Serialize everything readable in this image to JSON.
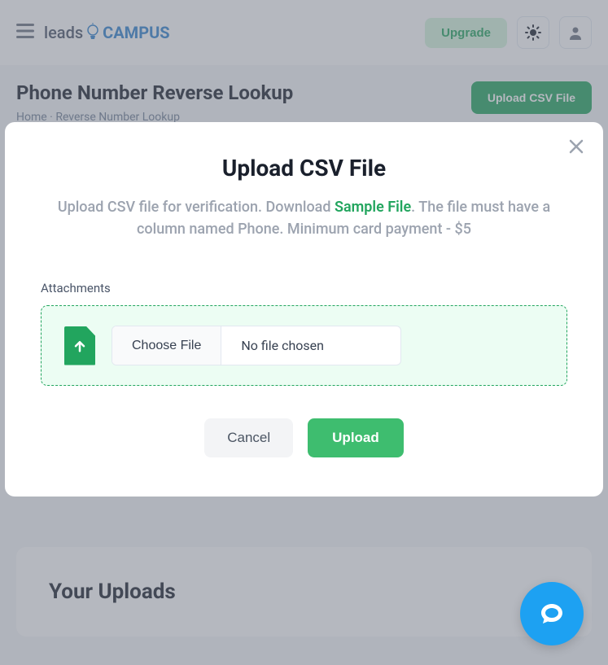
{
  "header": {
    "logo_leads": "leads",
    "logo_campus": "CAMPUS",
    "upgrade_label": "Upgrade"
  },
  "page": {
    "title": "Phone Number Reverse Lookup",
    "breadcrumb_home": "Home",
    "breadcrumb_current": "Reverse Number Lookup",
    "upload_csv_label": "Upload CSV File"
  },
  "uploads": {
    "title": "Your Uploads"
  },
  "modal": {
    "title": "Upload CSV File",
    "subtitle_part1": "Upload CSV file for verification. Download ",
    "sample_file_label": "Sample File",
    "subtitle_part2": ". The file must have a column named Phone. Minimum card payment - $5",
    "attachments_label": "Attachments",
    "choose_file_label": "Choose File",
    "no_file_chosen": "No file chosen",
    "cancel_label": "Cancel",
    "upload_label": "Upload"
  }
}
